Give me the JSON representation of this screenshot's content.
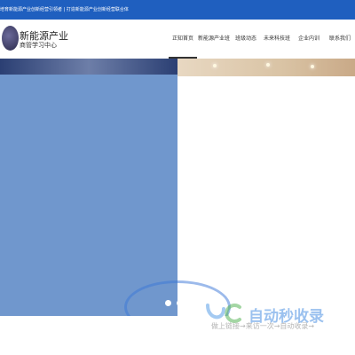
{
  "topbar": {
    "text": "培育新能源产业创新经营引领者 | 打造新能源产业创新经营联合体"
  },
  "header": {
    "brand_title": "新能源产业",
    "brand_subtitle": "商管学习中心"
  },
  "nav": {
    "items": [
      {
        "label": "正知首页"
      },
      {
        "label": "新能源产业班"
      },
      {
        "label": "班级动态"
      },
      {
        "label": "未来科技班"
      },
      {
        "label": "企业内训"
      },
      {
        "label": "联系我们"
      }
    ]
  },
  "carousel": {
    "slides": 2,
    "active_index": 0
  },
  "watermark": {
    "title": "自动秒收录",
    "subtitle": "做上链接→来访一次→自动收录→"
  }
}
